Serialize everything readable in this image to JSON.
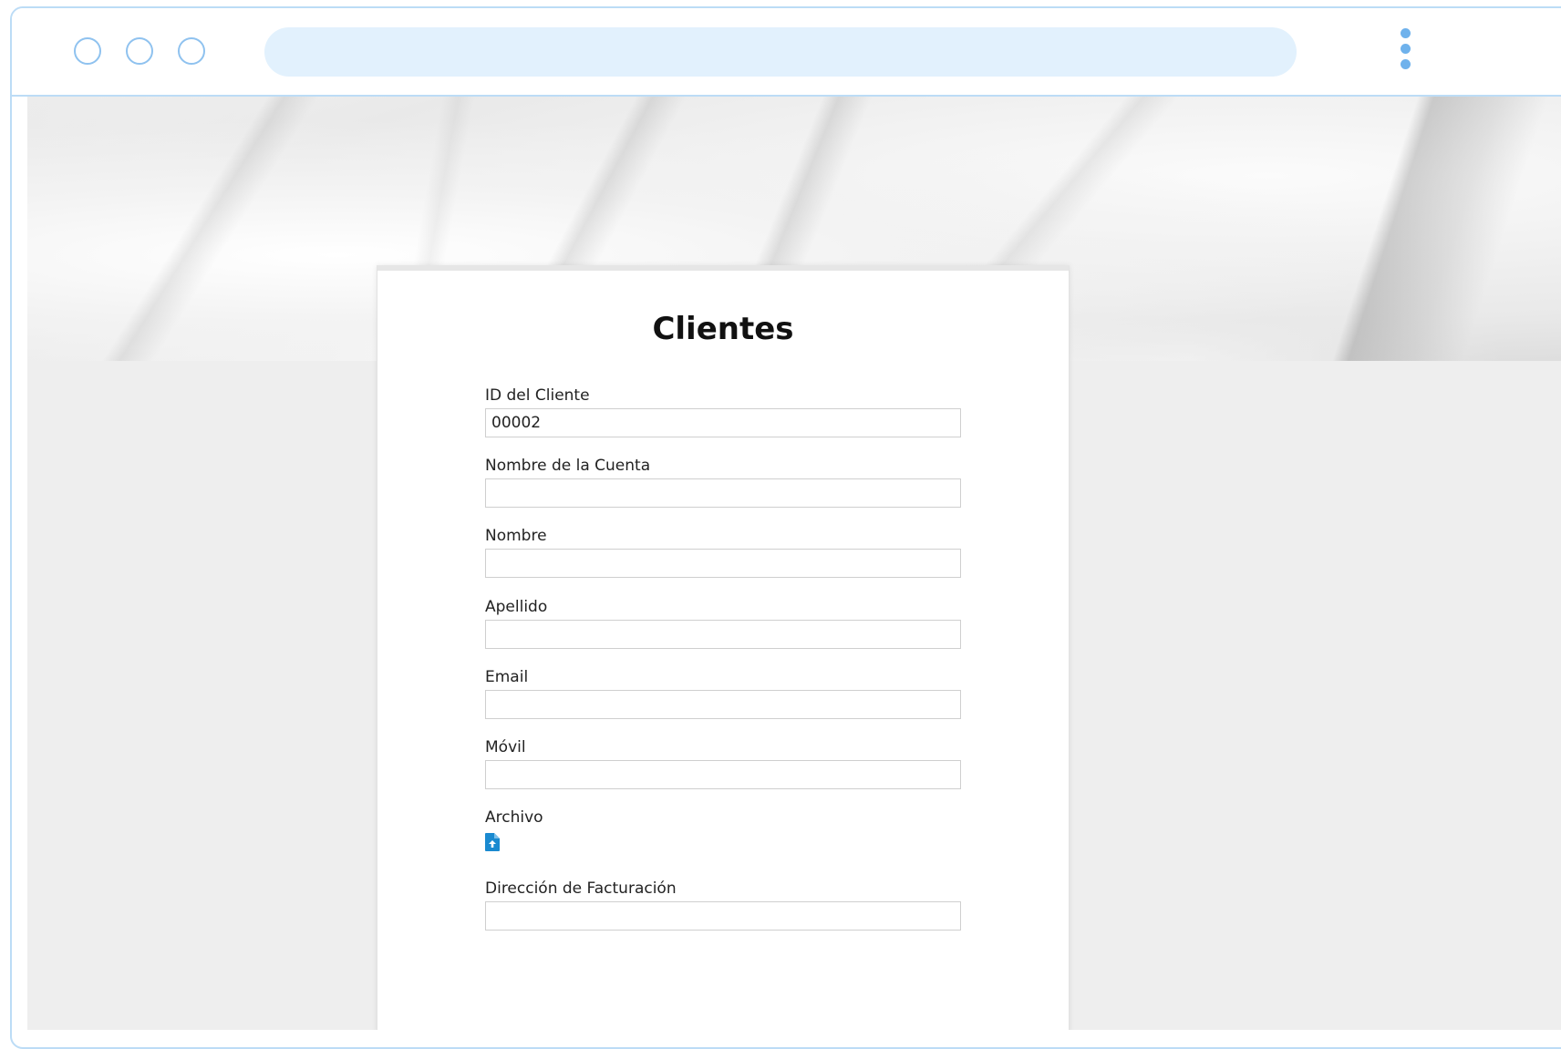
{
  "browser": {
    "address": ""
  },
  "form": {
    "title": "Clientes",
    "fields": [
      {
        "label": "ID del Cliente",
        "value": "00002"
      },
      {
        "label": "Nombre de la Cuenta",
        "value": ""
      },
      {
        "label": "Nombre",
        "value": ""
      },
      {
        "label": "Apellido",
        "value": ""
      },
      {
        "label": "Email",
        "value": ""
      },
      {
        "label": "Móvil",
        "value": ""
      }
    ],
    "file": {
      "label": "Archivo",
      "icon": "file-upload-icon"
    },
    "billing": {
      "label": "Dirección de Facturación",
      "value": ""
    }
  },
  "colors": {
    "window_border": "#bcdcf6",
    "address_bar": "#e2f1fd",
    "accent": "#1a8ad0",
    "page_background": "#eeeeee"
  }
}
